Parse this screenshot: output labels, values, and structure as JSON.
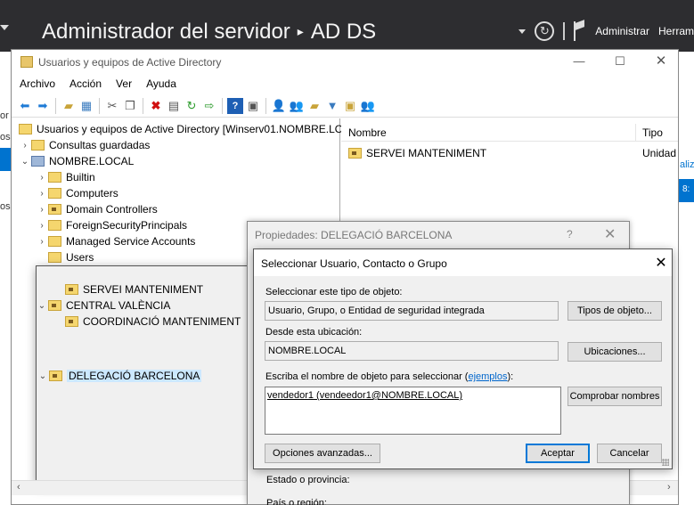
{
  "server_manager": {
    "title": "Administrador del servidor",
    "breadcrumb_sep": "▸",
    "section": "AD DS",
    "menu_manage": "Administrar",
    "menu_tools": "Herram",
    "side_fragments": [
      "or",
      "os",
      "os"
    ],
    "right_fragments": [
      "aliz",
      "8:"
    ]
  },
  "aduc": {
    "title": "Usuarios y equipos de Active Directory",
    "menu": [
      "Archivo",
      "Acción",
      "Ver",
      "Ayuda"
    ],
    "toolbar_icons": [
      "back-icon",
      "forward-icon",
      "up-folder-icon",
      "show-console-tree-icon",
      "cut-icon",
      "copy-icon",
      "delete-icon",
      "properties-icon",
      "refresh-icon",
      "export-icon",
      "help-icon",
      "console-icon",
      "new-user-icon",
      "new-group-icon",
      "new-ou-icon",
      "filter-icon",
      "add-to-group-icon",
      "delegate-icon"
    ],
    "tree": {
      "root": "Usuarios y equipos de Active Directory [Winserv01.NOMBRE.LOC",
      "items": [
        {
          "label": "Consultas guardadas"
        },
        {
          "label": "NOMBRE.LOCAL"
        },
        {
          "label": "Builtin"
        },
        {
          "label": "Computers"
        },
        {
          "label": "Domain Controllers"
        },
        {
          "label": "ForeignSecurityPrincipals"
        },
        {
          "label": "Managed Service Accounts"
        },
        {
          "label": "Users"
        },
        {
          "label": "DELEGACIÓ BARCELONA"
        },
        {
          "label": "SERVEI MANTENIMENT"
        },
        {
          "label": "CENTRAL VALÈNCIA"
        },
        {
          "label": "COORDINACIÓ MANTENIMENT"
        }
      ]
    },
    "list": {
      "columns": [
        "Nombre",
        "Tipo"
      ],
      "rows": [
        {
          "name": "SERVEI MANTENIMENT",
          "type": "Unidad"
        }
      ]
    }
  },
  "properties_dialog": {
    "title": "Propiedades: DELEGACIÓ BARCELONA",
    "help": "?",
    "labels": [
      "Estado o provincia:",
      "País o región:"
    ]
  },
  "select_dialog": {
    "title": "Seleccionar Usuario, Contacto o Grupo",
    "object_type_label": "Seleccionar este tipo de objeto:",
    "object_type_value": "Usuario, Grupo, o Entidad de seguridad integrada",
    "object_types_button": "Tipos de objeto...",
    "location_label": "Desde esta ubicación:",
    "location_value": "NOMBRE.LOCAL",
    "locations_button": "Ubicaciones...",
    "names_label_prefix": "Escriba el nombre de objeto para seleccionar (",
    "names_label_link": "ejemplos",
    "names_label_suffix": "):",
    "names_value": "vendedor1 (vendeedor1@NOMBRE.LOCAL)",
    "check_names_button": "Comprobar nombres",
    "advanced_button": "Opciones avanzadas...",
    "ok_button": "Aceptar",
    "cancel_button": "Cancelar"
  }
}
